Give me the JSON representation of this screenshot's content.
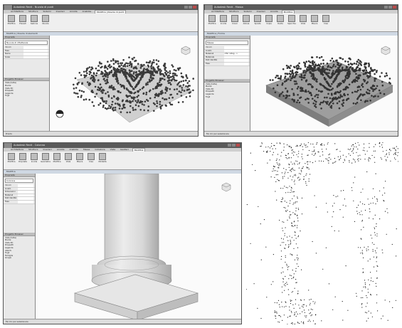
{
  "panels": [
    {
      "title": "Autodesk Revit - Nuvola di punti",
      "tabs": [
        "Architettura",
        "Struttura",
        "Sistemi",
        "Inserisci",
        "Annota",
        "Analizza",
        "Modifica | Nuvole di punti"
      ],
      "tools": [
        "Modifica",
        "Prevedi",
        "Sezione",
        "Nuvola"
      ],
      "context": "Modifica | Nuvole di elementi",
      "properties_header": "Proprietà",
      "type_selector": "Nuvola di riflettanza",
      "rows": [
        {
          "label": "Vincoli",
          "value": ""
        },
        {
          "label": "Fase",
          "value": ""
        },
        {
          "label": "Nome",
          "value": ""
        },
        {
          "label": "Scala",
          "value": ""
        }
      ],
      "tree_header": "Progetto Browser",
      "tree": [
        "Viste (tutte)",
        "Pianta",
        "Vista 3D",
        "Prospetti",
        "Legende",
        "Fogli"
      ],
      "status": "Pronto"
    },
    {
      "title": "Autodesk Revit - Massa",
      "tabs": [
        "Architettura",
        "Struttura",
        "Sistemi",
        "Inserisci",
        "Annota",
        "Modifica"
      ],
      "tools": [
        "Modifica",
        "Incolla",
        "Unisci",
        "Allinea",
        "Sposta",
        "Copia",
        "Ruota",
        "Specchia",
        "Vista",
        "Misura",
        "Crea"
      ],
      "context": "Modifica | Forma",
      "properties_header": "Proprietà",
      "type_selector": "Massa",
      "rows": [
        {
          "label": "Vincoli",
          "value": ""
        },
        {
          "label": "Livello",
          "value": ""
        },
        {
          "label": "Materiali",
          "value": "<Per categ...>"
        },
        {
          "label": "Materiale",
          "value": ""
        },
        {
          "label": "Dati identità",
          "value": ""
        },
        {
          "label": "Fase",
          "value": ""
        }
      ],
      "tree_header": "Progetto Browser",
      "tree": [
        "Viste (tutte)",
        "Piante",
        "Vista 3D",
        "Prospetti",
        "Legende",
        "Fogli"
      ],
      "status": "Fai clic per selezionare"
    },
    {
      "title": "Autodesk Revit - Colonna",
      "tabs": [
        "Architettura",
        "Struttura",
        "Inserisci",
        "Annota",
        "Analizza",
        "Massa",
        "Collabora",
        "Vista",
        "Gestisci",
        "Modifica"
      ],
      "tools": [
        "Modifica",
        "Proprietà",
        "Incolla",
        "Geometria",
        "Modifica",
        "Vista",
        "Misura",
        "Crea",
        "Modalità"
      ],
      "context": "Modifica",
      "properties_header": "Proprietà",
      "type_selector": "Colonna",
      "rows": [
        {
          "label": "Vincoli",
          "value": ""
        },
        {
          "label": "Livello",
          "value": ""
        },
        {
          "label": "Dimensioni",
          "value": ""
        },
        {
          "label": "Materiali",
          "value": ""
        },
        {
          "label": "Dati identità",
          "value": ""
        },
        {
          "label": "Fase",
          "value": ""
        }
      ],
      "tree_header": "Progetto Browser",
      "tree": [
        "Viste (tutte)",
        "Piante",
        "Vista 3D",
        "Prospetti",
        "Legende",
        "Abachi",
        "Fogli",
        "Famiglie",
        "Gruppi"
      ],
      "status": "Fai clic per selezionare"
    }
  ]
}
